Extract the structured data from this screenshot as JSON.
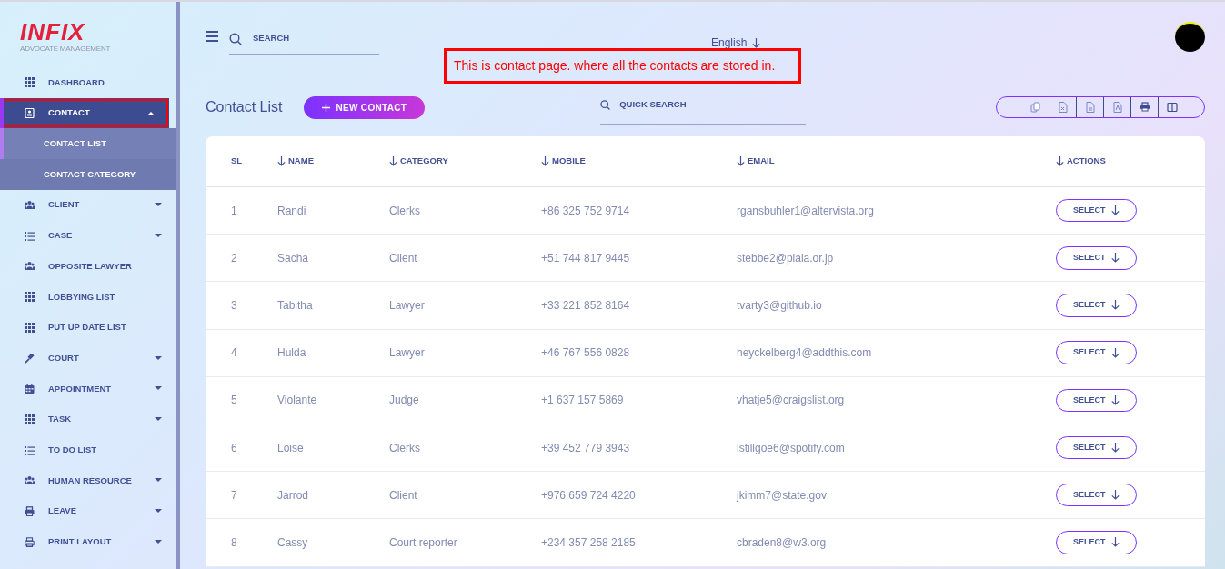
{
  "logo": {
    "brand": "INFIX",
    "tagline": "ADVOCATE MANAGEMENT"
  },
  "sidebar": {
    "items": [
      {
        "label": "DASHBOARD",
        "kind": "grid",
        "expandable": false,
        "selected": false,
        "highlighted": false
      },
      {
        "label": "CONTACT",
        "kind": "contact",
        "expandable": true,
        "expanded": true,
        "selected": true,
        "highlighted": true,
        "children": [
          {
            "label": "CONTACT LIST",
            "selected": true
          },
          {
            "label": "CONTACT CATEGORY",
            "selected": false
          }
        ]
      },
      {
        "label": "CLIENT",
        "kind": "users",
        "expandable": true,
        "expanded": false,
        "selected": false,
        "highlighted": false
      },
      {
        "label": "CASE",
        "kind": "list",
        "expandable": true,
        "expanded": false,
        "selected": false,
        "highlighted": false
      },
      {
        "label": "OPPOSITE LAWYER",
        "kind": "users",
        "expandable": false,
        "selected": false,
        "highlighted": false
      },
      {
        "label": "LOBBYING LIST",
        "kind": "grid",
        "expandable": false,
        "selected": false,
        "highlighted": false
      },
      {
        "label": "PUT UP DATE LIST",
        "kind": "grid",
        "expandable": false,
        "selected": false,
        "highlighted": false
      },
      {
        "label": "COURT",
        "kind": "gavel",
        "expandable": true,
        "expanded": false,
        "selected": false,
        "highlighted": false
      },
      {
        "label": "APPOINTMENT",
        "kind": "calendar",
        "expandable": true,
        "expanded": false,
        "selected": false,
        "highlighted": false
      },
      {
        "label": "TASK",
        "kind": "grid",
        "expandable": true,
        "expanded": false,
        "selected": false,
        "highlighted": false
      },
      {
        "label": "TO DO LIST",
        "kind": "list",
        "expandable": false,
        "selected": false,
        "highlighted": false
      },
      {
        "label": "HUMAN RESOURCE",
        "kind": "users",
        "expandable": true,
        "expanded": false,
        "selected": false,
        "highlighted": false
      },
      {
        "label": "LEAVE",
        "kind": "printer",
        "expandable": true,
        "expanded": false,
        "selected": false,
        "highlighted": false
      },
      {
        "label": "PRINT LAYOUT",
        "kind": "printer2",
        "expandable": true,
        "expanded": false,
        "selected": false,
        "highlighted": false
      }
    ]
  },
  "topbar": {
    "search": {
      "placeholder": "SEARCH"
    },
    "language": "English"
  },
  "annotation": "This is contact page. where all the contacts are stored in.",
  "page": {
    "title": "Contact List",
    "new_button": "NEW CONTACT",
    "quick_search": {
      "placeholder": "QUICK SEARCH"
    }
  },
  "table": {
    "columns": [
      {
        "label": "SL",
        "sortable": false
      },
      {
        "label": "NAME",
        "sortable": true
      },
      {
        "label": "CATEGORY",
        "sortable": true
      },
      {
        "label": "MOBILE",
        "sortable": true
      },
      {
        "label": "EMAIL",
        "sortable": true
      },
      {
        "label": "ACTIONS",
        "sortable": true
      }
    ],
    "rows": [
      {
        "sl": "1",
        "name": "Randi",
        "category": "Clerks",
        "mobile": "+86 325 752 9714",
        "email": "rgansbuhler1@altervista.org",
        "action": "SELECT"
      },
      {
        "sl": "2",
        "name": "Sacha",
        "category": "Client",
        "mobile": "+51 744 817 9445",
        "email": "stebbe2@plala.or.jp",
        "action": "SELECT"
      },
      {
        "sl": "3",
        "name": "Tabitha",
        "category": "Lawyer",
        "mobile": "+33 221 852 8164",
        "email": "tvarty3@github.io",
        "action": "SELECT"
      },
      {
        "sl": "4",
        "name": "Hulda",
        "category": "Lawyer",
        "mobile": "+46 767 556 0828",
        "email": "heyckelberg4@addthis.com",
        "action": "SELECT"
      },
      {
        "sl": "5",
        "name": "Violante",
        "category": "Judge",
        "mobile": "+1 637 157 5869",
        "email": "vhatje5@craigslist.org",
        "action": "SELECT"
      },
      {
        "sl": "6",
        "name": "Loise",
        "category": "Clerks",
        "mobile": "+39 452 779 3943",
        "email": "lstillgoe6@spotify.com",
        "action": "SELECT"
      },
      {
        "sl": "7",
        "name": "Jarrod",
        "category": "Client",
        "mobile": "+976 659 724 4220",
        "email": "jkimm7@state.gov",
        "action": "SELECT"
      },
      {
        "sl": "8",
        "name": "Cassy",
        "category": "Court reporter",
        "mobile": "+234 357 258 2185",
        "email": "cbraden8@w3.org",
        "action": "SELECT"
      }
    ]
  }
}
